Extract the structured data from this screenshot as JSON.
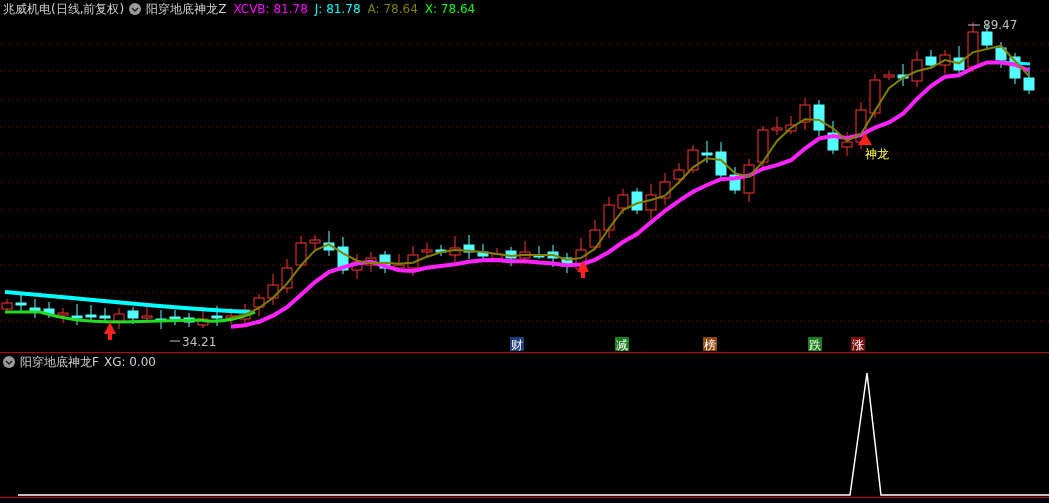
{
  "header": {
    "title": "兆威机电(日线,前复权)",
    "indicator": "阳穿地底神龙Z",
    "values": [
      {
        "label": "XCVB: 81.78",
        "color": "#ff00ff"
      },
      {
        "label": "J: 81.78",
        "color": "#00ffff"
      },
      {
        "label": "A: 78.64",
        "color": "#808000"
      },
      {
        "label": "X: 78.64",
        "color": "#00ff00"
      }
    ]
  },
  "price_chart": {
    "high_label": "89.47",
    "low_label": "34.21",
    "signal_label": "神龙"
  },
  "event_tags": [
    {
      "label": "财",
      "color": "#1a3f7a"
    },
    {
      "label": "减",
      "color": "#1c7d1c"
    },
    {
      "label": "榜",
      "color": "#8c4a0c"
    },
    {
      "label": "跌",
      "color": "#1c7d1c"
    },
    {
      "label": "涨",
      "color": "#7d0c0c"
    }
  ],
  "lower_panel": {
    "indicator": "阳穿地底神龙F",
    "value": "XG: 0.00"
  }
}
